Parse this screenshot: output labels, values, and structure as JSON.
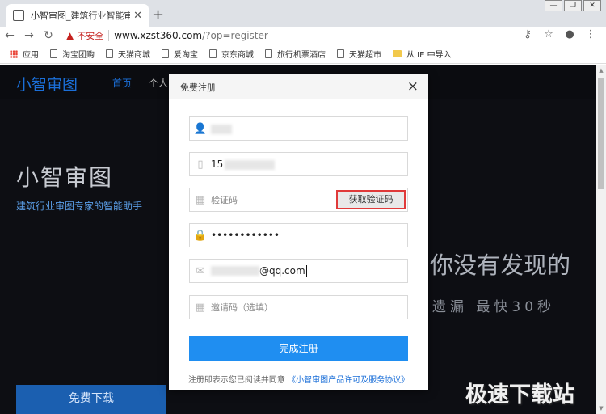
{
  "browser": {
    "tab_title": "小智审图_建筑行业智能审图助手",
    "new_tab": "+",
    "insecure_label": "不安全",
    "url_host": "www.xzst360.com",
    "url_path": "/?op=register",
    "bookmarks": [
      "应用",
      "淘宝团购",
      "天猫商城",
      "爱淘宝",
      "京东商城",
      "旅行机票酒店",
      "天猫超市",
      "从 IE 中导入"
    ]
  },
  "page": {
    "logo": "小智审图",
    "nav_home": "首页",
    "nav_personal": "个人",
    "hero_title": "小智审图",
    "hero_subtitle": "建筑行业审图专家的智能助手",
    "promo_line1": "你没有发现的",
    "promo_line2": "遗漏  最快30秒",
    "download_button": "免费下载",
    "watermark": "极速下载站"
  },
  "modal": {
    "title": "免费注册",
    "close": "×",
    "username_value": "",
    "phone_value": "15",
    "code_placeholder": "验证码",
    "get_code_button": "获取验证码",
    "password_value": "••••••••••••",
    "email_value": "@qq.com",
    "invite_placeholder": "邀请码（选填）",
    "submit_button": "完成注册",
    "agreement_text": "注册即表示您已阅读并同意",
    "agreement_link": "《小智审图产品许可及服务协议》"
  }
}
